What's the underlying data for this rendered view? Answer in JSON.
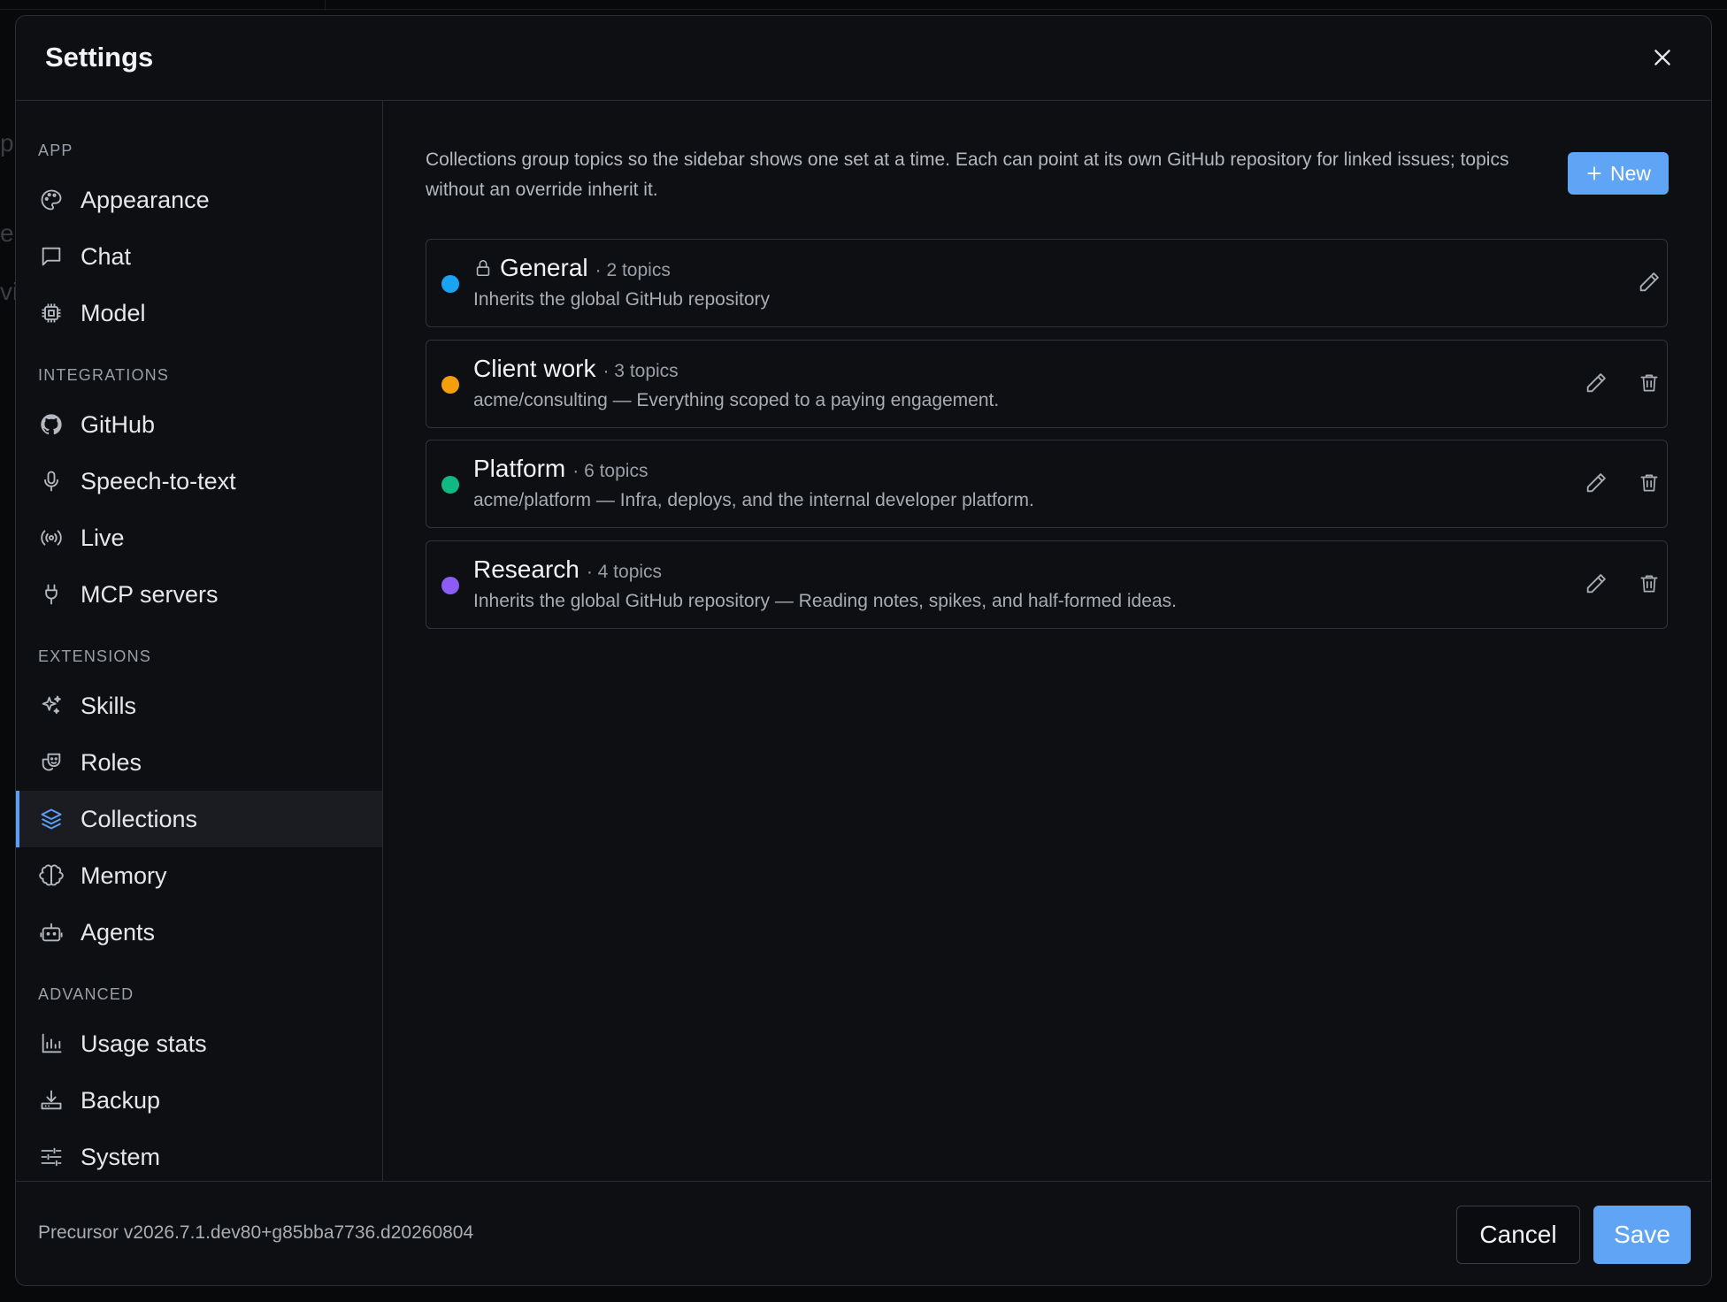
{
  "modal": {
    "title": "Settings"
  },
  "sidebar": {
    "sections": [
      {
        "label": "APP",
        "items": [
          {
            "label": "Appearance",
            "icon": "palette-icon"
          },
          {
            "label": "Chat",
            "icon": "message-square-icon"
          },
          {
            "label": "Model",
            "icon": "cpu-chip-icon"
          }
        ]
      },
      {
        "label": "INTEGRATIONS",
        "items": [
          {
            "label": "GitHub",
            "icon": "github-icon"
          },
          {
            "label": "Speech-to-text",
            "icon": "microphone-icon"
          },
          {
            "label": "Live",
            "icon": "broadcast-icon"
          },
          {
            "label": "MCP servers",
            "icon": "plug-icon"
          }
        ]
      },
      {
        "label": "EXTENSIONS",
        "items": [
          {
            "label": "Skills",
            "icon": "sparkles-icon"
          },
          {
            "label": "Roles",
            "icon": "theater-masks-icon"
          },
          {
            "label": "Collections",
            "icon": "layers-icon",
            "active": true
          },
          {
            "label": "Memory",
            "icon": "brain-icon"
          },
          {
            "label": "Agents",
            "icon": "bot-icon"
          }
        ]
      },
      {
        "label": "ADVANCED",
        "items": [
          {
            "label": "Usage stats",
            "icon": "bar-chart-icon"
          },
          {
            "label": "Backup",
            "icon": "download-tray-icon"
          },
          {
            "label": "System",
            "icon": "sliders-icon"
          }
        ]
      }
    ]
  },
  "content": {
    "description": "Collections group topics so the sidebar shows one set at a time. Each can point at its own GitHub repository for linked issues; topics without an override inherit it.",
    "new_button": "New",
    "collections": [
      {
        "name": "General",
        "count": "· 2 topics",
        "subtitle": "Inherits the global GitHub repository",
        "color": "#1aa3f0",
        "locked": true
      },
      {
        "name": "Client work",
        "count": "· 3 topics",
        "subtitle": "acme/consulting — Everything scoped to a paying engagement.",
        "color": "#f59e0b",
        "locked": false
      },
      {
        "name": "Platform",
        "count": "· 6 topics",
        "subtitle": "acme/platform — Infra, deploys, and the internal developer platform.",
        "color": "#10b981",
        "locked": false
      },
      {
        "name": "Research",
        "count": "· 4 topics",
        "subtitle": "Inherits the global GitHub repository — Reading notes, spikes, and half-formed ideas.",
        "color": "#8b5cf6",
        "locked": false
      }
    ]
  },
  "footer": {
    "version": "Precursor v2026.7.1.dev80+g85bba7736.d20260804",
    "cancel": "Cancel",
    "save": "Save"
  },
  "colors": {
    "accent": "#60a5f5",
    "background": "#0d0f13",
    "border": "#2a2d33"
  }
}
